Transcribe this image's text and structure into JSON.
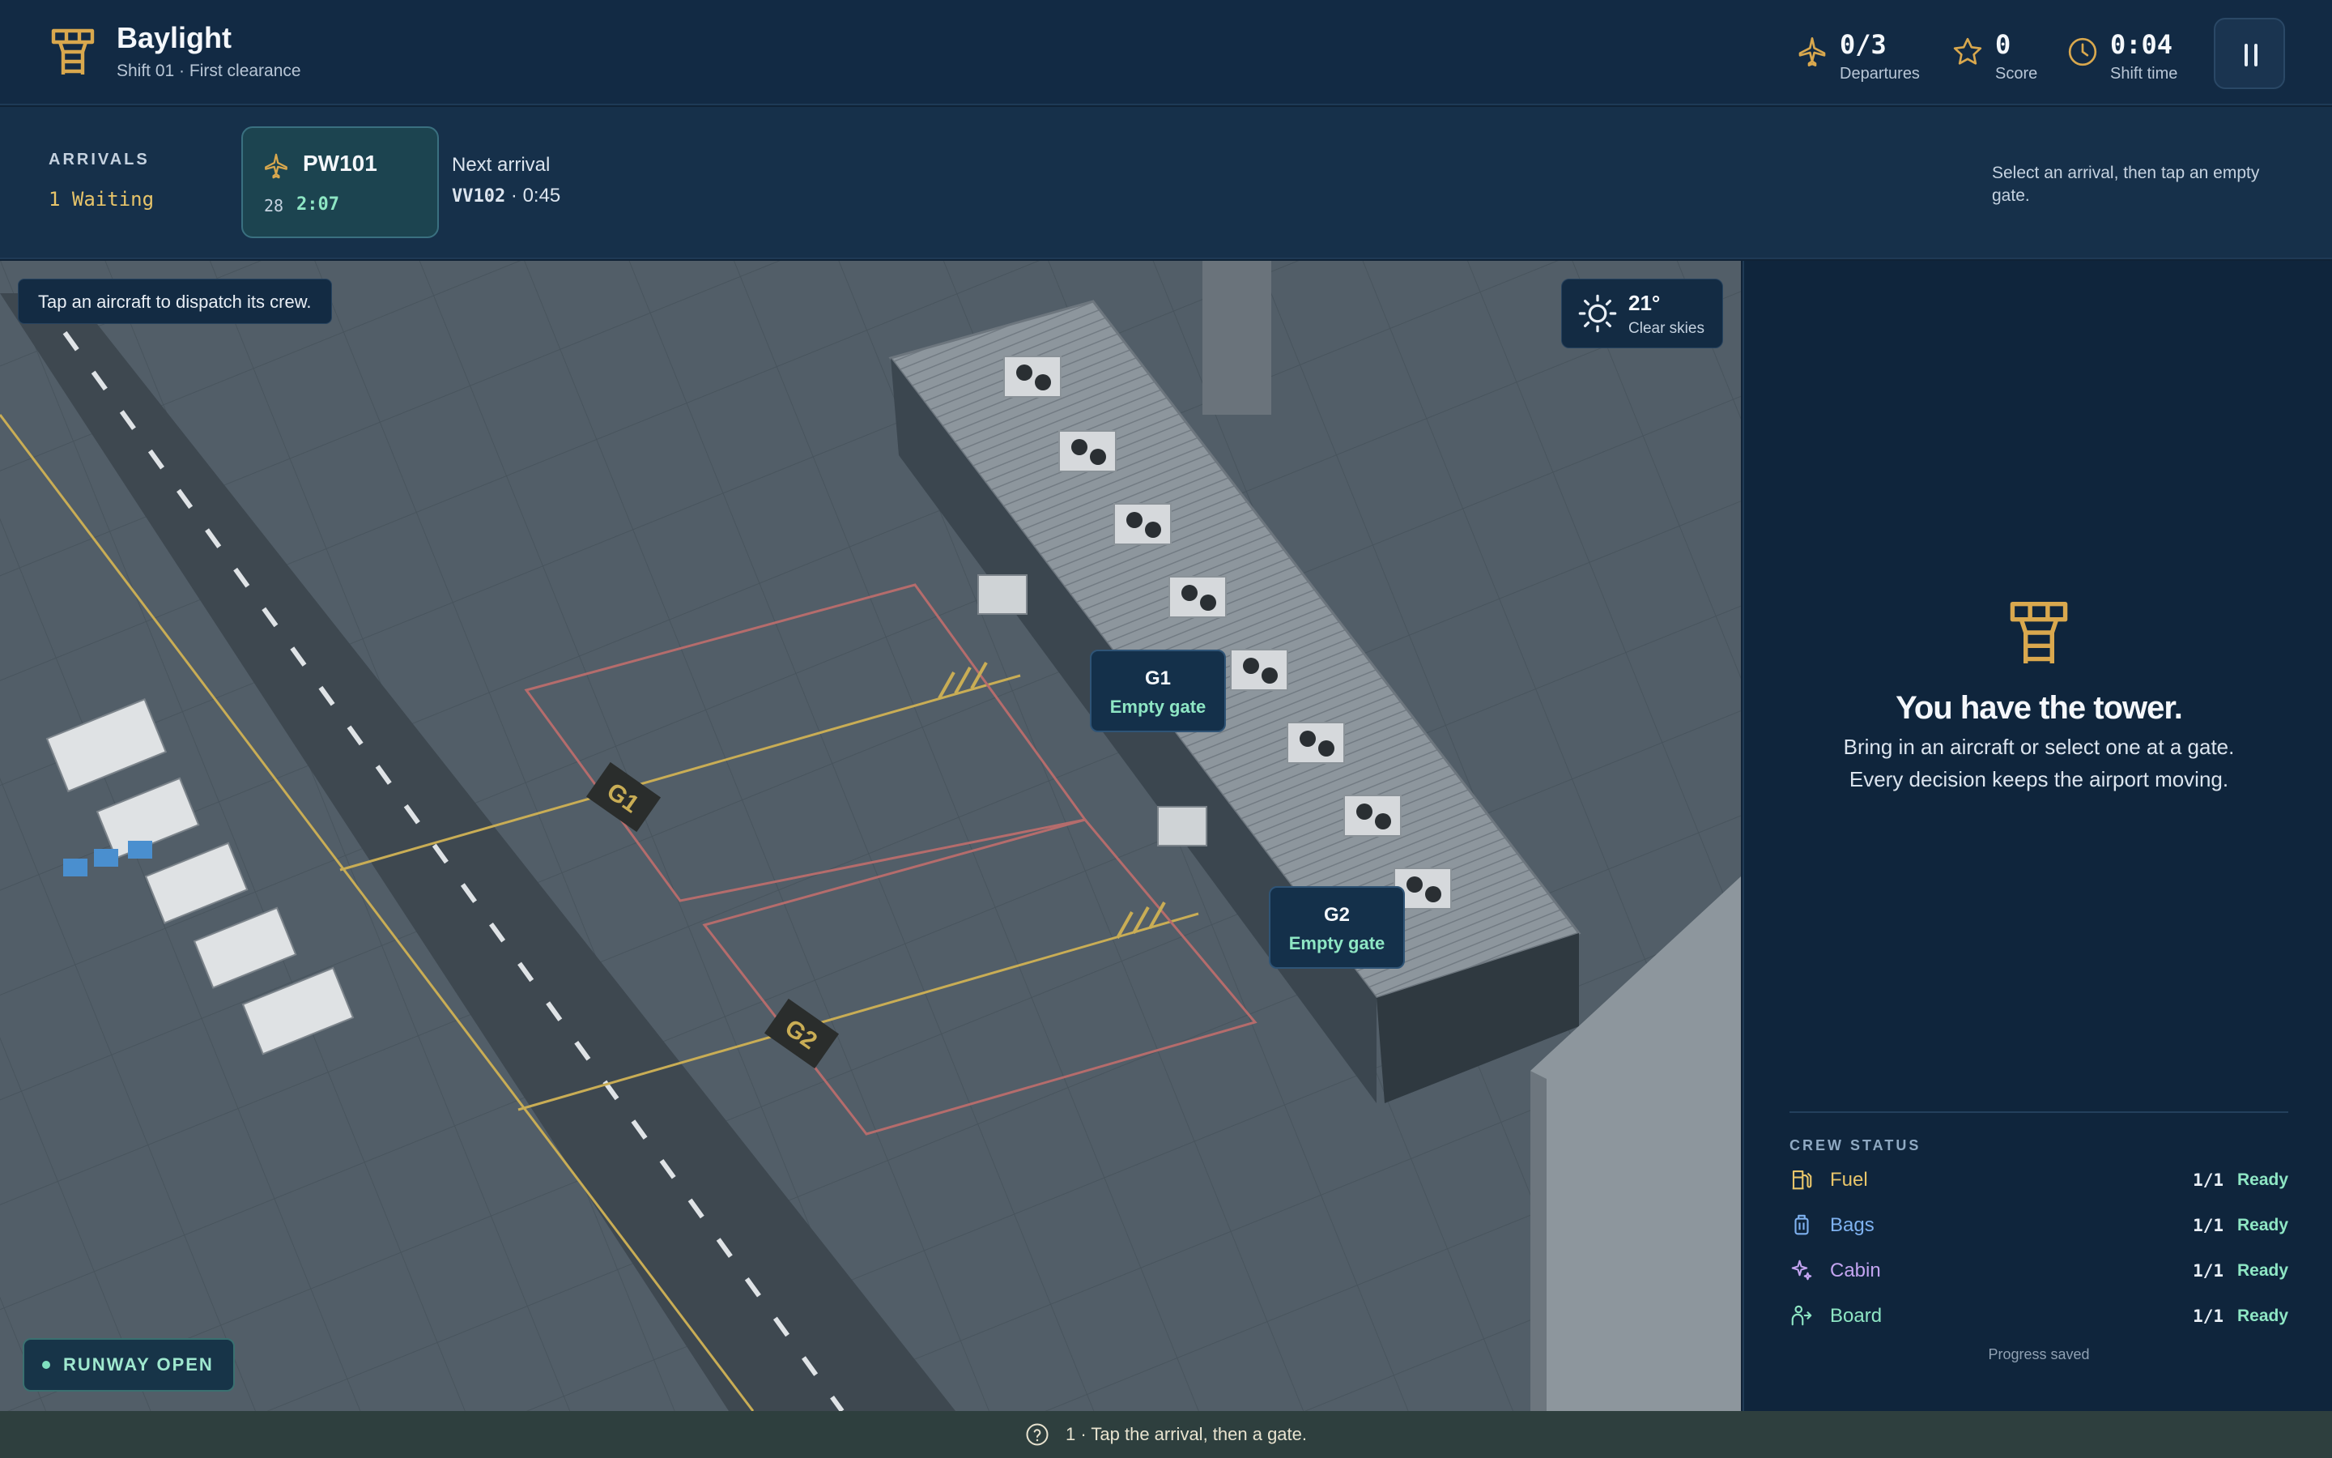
{
  "header": {
    "app_name": "Baylight",
    "shift": "Shift 01 · First clearance",
    "departures": {
      "value": "0/3",
      "label": "Departures"
    },
    "score": {
      "value": "0",
      "label": "Score"
    },
    "shift_time": {
      "value": "0:04",
      "label": "Shift time"
    }
  },
  "arrivals": {
    "heading": "ARRIVALS",
    "waiting": "1 Waiting",
    "selected_flight": {
      "code": "PW101",
      "number": "28",
      "time": "2:07"
    },
    "next_label": "Next arrival",
    "next_code": "VV102",
    "next_time": "0:45",
    "hint": "Select an arrival, then tap an empty gate."
  },
  "map": {
    "tip": "Tap an aircraft to dispatch its crew.",
    "weather": {
      "temp": "21°",
      "condition": "Clear skies"
    },
    "gates": [
      {
        "id": "G1",
        "state": "Empty gate"
      },
      {
        "id": "G2",
        "state": "Empty gate"
      }
    ],
    "pavement_markings": [
      "G1",
      "G2"
    ],
    "runway_status": "RUNWAY OPEN"
  },
  "panel": {
    "title": "You have the tower.",
    "body_line1": "Bring in an aircraft or select one at a gate.",
    "body_line2": "Every decision keeps the airport moving.",
    "crew_heading": "CREW STATUS",
    "crew": [
      {
        "name": "Fuel",
        "count": "1/1",
        "status": "Ready",
        "color": "#e8c56a",
        "icon": "fuel-pump-icon"
      },
      {
        "name": "Bags",
        "count": "1/1",
        "status": "Ready",
        "color": "#7fb2f0",
        "icon": "luggage-icon"
      },
      {
        "name": "Cabin",
        "count": "1/1",
        "status": "Ready",
        "color": "#c3a4f0",
        "icon": "sparkle-icon"
      },
      {
        "name": "Board",
        "count": "1/1",
        "status": "Ready",
        "color": "#8ee6c4",
        "icon": "person-board-icon"
      }
    ],
    "saved": "Progress saved"
  },
  "footer": {
    "text": "1 · Tap the arrival, then a gate."
  },
  "colors": {
    "accent": "#d9a84e",
    "ready": "#8ee6c4",
    "background": "#0f2236"
  }
}
